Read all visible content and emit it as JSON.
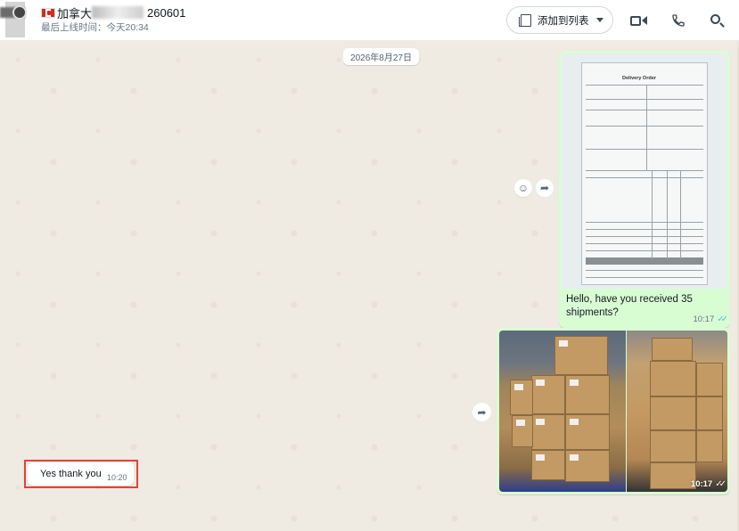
{
  "header": {
    "contact_name_prefix": "加拿大",
    "contact_name_suffix": "260601",
    "last_seen": "最后上线时间：今天20:34",
    "add_to_list_label": "添加到列表",
    "icons": [
      "video-call-icon",
      "phone-icon",
      "search-icon"
    ]
  },
  "chat": {
    "date_label": "2026年8月27日",
    "messages": [
      {
        "direction": "out",
        "type": "image",
        "image_desc": "document",
        "doc_title": "Delivery Order",
        "text": "Hello, have you received 35 shipments?",
        "time": "10:17",
        "status": "read"
      },
      {
        "direction": "out",
        "type": "image",
        "image_desc": "two photos of stacked cardboard boxes",
        "time": "10:17",
        "status": "read"
      },
      {
        "direction": "in",
        "type": "text",
        "text": "Yes thank you",
        "time": "10:20"
      }
    ]
  },
  "colors": {
    "outgoing_bubble": "#d9fdd3",
    "incoming_bubble": "#ffffff",
    "chat_background": "#efeae2",
    "read_ticks": "#53bdeb",
    "highlight_border": "#e0443a"
  }
}
